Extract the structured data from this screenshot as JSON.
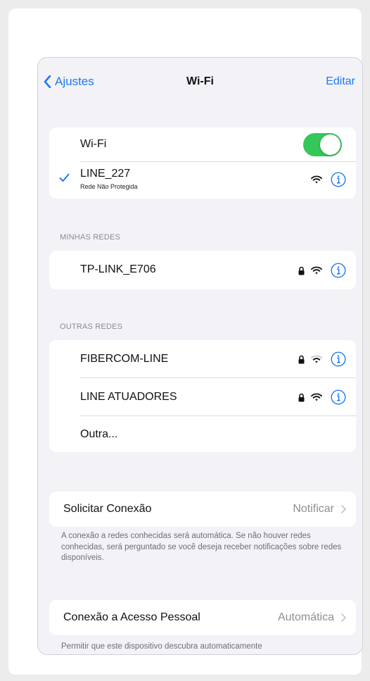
{
  "nav": {
    "back_label": "Ajustes",
    "title": "Wi-Fi",
    "edit_label": "Editar"
  },
  "wifi": {
    "toggle_label": "Wi-Fi",
    "toggle_on": true,
    "connected_network": "LINE_227",
    "connected_subtitle": "Rede Não Protegida"
  },
  "my_networks": {
    "header": "MINHAS REDES",
    "items": [
      {
        "name": "TP-LINK_E706",
        "locked": true
      }
    ]
  },
  "other_networks": {
    "header": "OUTRAS REDES",
    "items": [
      {
        "name": "FIBERCOM-LINE",
        "locked": true
      },
      {
        "name": "LINE ATUADORES",
        "locked": true
      }
    ],
    "other_label": "Outra..."
  },
  "ask_to_join": {
    "label": "Solicitar Conexão",
    "value": "Notificar",
    "description": "A conexão a redes conhecidas será automática. Se não houver redes conhecidas, será perguntado se você deseja receber notificações sobre redes disponíveis."
  },
  "hotspot": {
    "label": "Conexão a Acesso Pessoal",
    "value": "Automática",
    "description": "Permitir que este dispositivo descubra automaticamente"
  },
  "colors": {
    "accent": "#1e79f0",
    "toggle_on": "#34c759",
    "background": "#f2f2f7"
  }
}
